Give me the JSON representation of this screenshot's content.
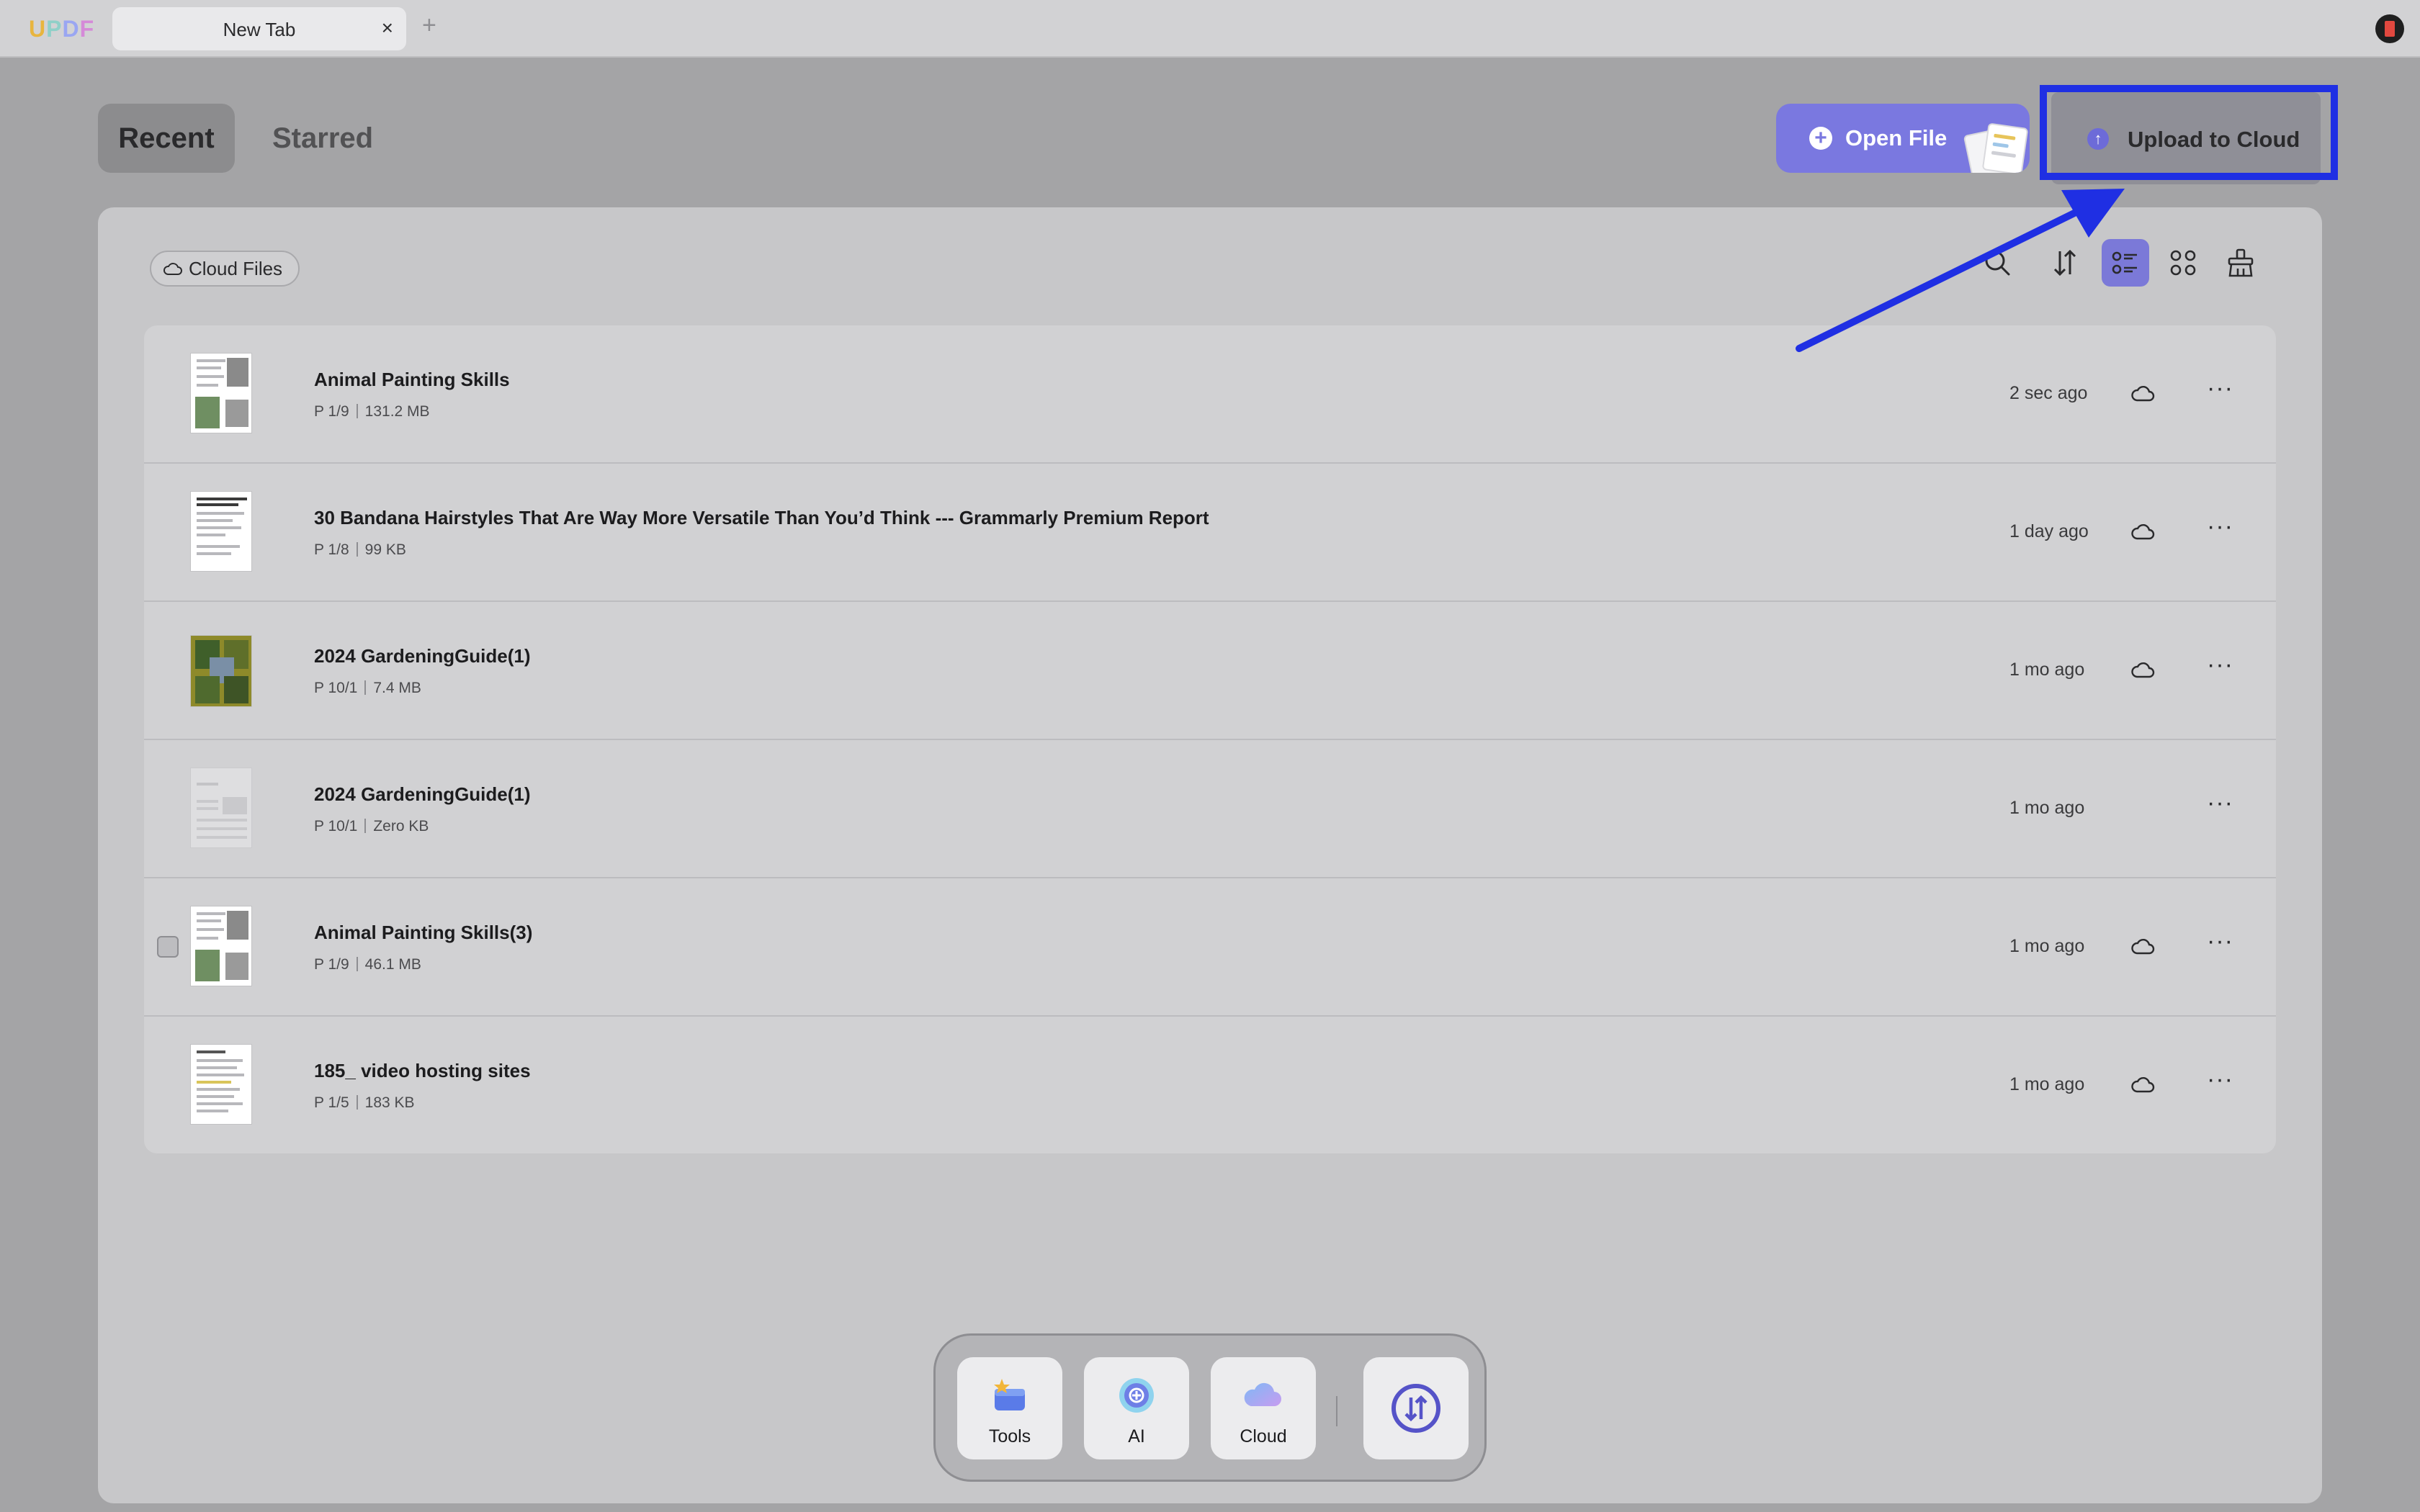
{
  "app": {
    "logo_letters": [
      "U",
      "P",
      "D",
      "F"
    ],
    "tab_title": "New Tab",
    "tab_close": "×",
    "tab_add": "+"
  },
  "nav": {
    "recent": "Recent",
    "starred": "Starred"
  },
  "actions": {
    "open_file": "Open File",
    "upload_to_cloud": "Upload to Cloud"
  },
  "filter": {
    "cloud_files": "Cloud Files"
  },
  "toolbar_icons": [
    "search-icon",
    "sort-icon",
    "list-view-icon",
    "grid-view-icon",
    "clean-icon"
  ],
  "files": [
    {
      "name": "Animal Painting Skills",
      "pages": "P 1/9",
      "size": "131.2 MB",
      "time": "2 sec ago",
      "cloud": true,
      "thumb": "art"
    },
    {
      "name": "30 Bandana Hairstyles That Are Way More Versatile Than You’d Think --- Grammarly Premium Report",
      "pages": "P 1/8",
      "size": "99 KB",
      "time": "1 day ago",
      "cloud": true,
      "thumb": "text"
    },
    {
      "name": "2024 GardeningGuide(1)",
      "pages": "P 10/1",
      "size": "7.4 MB",
      "time": "1 mo ago",
      "cloud": true,
      "thumb": "garden"
    },
    {
      "name": "2024 GardeningGuide(1)",
      "pages": "P 10/1",
      "size": "Zero KB",
      "time": "1 mo ago",
      "cloud": false,
      "thumb": "blank"
    },
    {
      "name": "Animal Painting Skills(3)",
      "pages": "P 1/9",
      "size": "46.1 MB",
      "time": "1 mo ago",
      "cloud": true,
      "thumb": "art"
    },
    {
      "name": "185_ video hosting sites",
      "pages": "P 1/5",
      "size": "183 KB",
      "time": "1 mo ago",
      "cloud": true,
      "thumb": "text"
    }
  ],
  "more_glyph": "···",
  "dock": {
    "tools": "Tools",
    "ai": "AI",
    "cloud": "Cloud"
  },
  "colors": {
    "accent": "#7a78e0",
    "annotation": "#1f2fe3"
  }
}
